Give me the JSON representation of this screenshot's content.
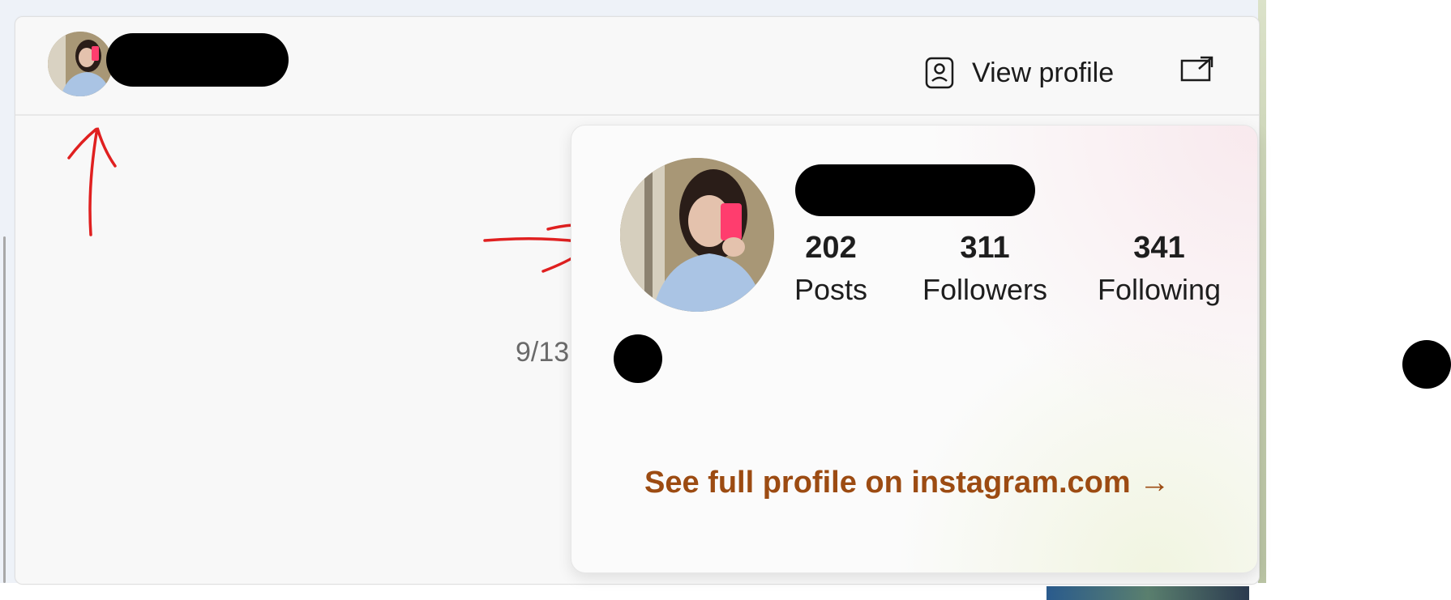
{
  "header": {
    "view_profile_label": "View profile",
    "view_profile_icon": "person-card-icon",
    "open_external_icon": "open-external-icon"
  },
  "counter": "9/13",
  "popup": {
    "stats": [
      {
        "value": "202",
        "label": "Posts"
      },
      {
        "value": "311",
        "label": "Followers"
      },
      {
        "value": "341",
        "label": "Following"
      }
    ],
    "link_label": "See full profile on instagram.com →"
  },
  "colors": {
    "link": "#9c4b12",
    "annotation": "#e02020"
  }
}
